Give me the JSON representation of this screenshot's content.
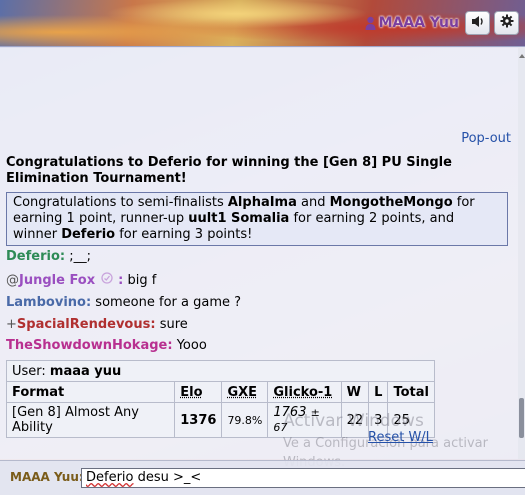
{
  "header": {
    "username": "MAAA Yuu",
    "user_icon": "user-icon",
    "sound_icon": "volume-icon",
    "settings_icon": "gear-icon"
  },
  "chat": {
    "popout_label": "Pop-out",
    "tournament": {
      "title": "Congratulations to Deferio for winning the [Gen 8] PU Single Elimination Tournament!",
      "p1": "Congratulations to semi-finalists ",
      "semi1": "AlphaIma",
      "and": " and ",
      "semi2": "MongotheMongo",
      "p2": " for earning 1 point, runner-up ",
      "runner": "uult1 Somalia",
      "p3": " for earning 2 points, and winner ",
      "winner": "Deferio",
      "p4": " for earning 3 points!"
    },
    "messages": [
      {
        "rank": "",
        "user": "Deferio:",
        "text": ";__;",
        "color": "#2e8b57"
      },
      {
        "rank": "@",
        "user": "Jungle Fox",
        "badge": "ₘ↻",
        "suffix": ":",
        "text": "big f",
        "color": "#9a4fc0"
      },
      {
        "rank": "",
        "user": "Lambovino:",
        "text": "someone for a game ?",
        "color": "#4a6aa8"
      },
      {
        "rank": "+",
        "user": "SpacialRendevous:",
        "text": "sure",
        "color": "#b03030"
      },
      {
        "rank": "",
        "user": "TheShowdownHokage:",
        "text": "Yooo",
        "color": "#b83090"
      }
    ],
    "ladder": {
      "user_label": "User: ",
      "user": "maaa yuu",
      "headers": [
        "Format",
        "Elo",
        "GXE",
        "Glicko-1",
        "W",
        "L",
        "Total"
      ],
      "row": {
        "format": "[Gen 8] Almost Any Ability",
        "elo": "1376",
        "gxe": "79.8%",
        "glicko": "1763",
        "glicko_dev": "± 67",
        "w": "22",
        "l": "3",
        "total": "25"
      },
      "reset_label": "Reset W/L"
    },
    "watermark": {
      "title": "Activar Windows",
      "subtitle": "Ve a Configuración para activar Windows."
    }
  },
  "input": {
    "user_label": "MAAA Yuu:",
    "value_word": "Deferio",
    "value_rest": " desu >_<"
  },
  "colors": {
    "link": "#2551a8",
    "header_username": "#7b3f9e"
  }
}
